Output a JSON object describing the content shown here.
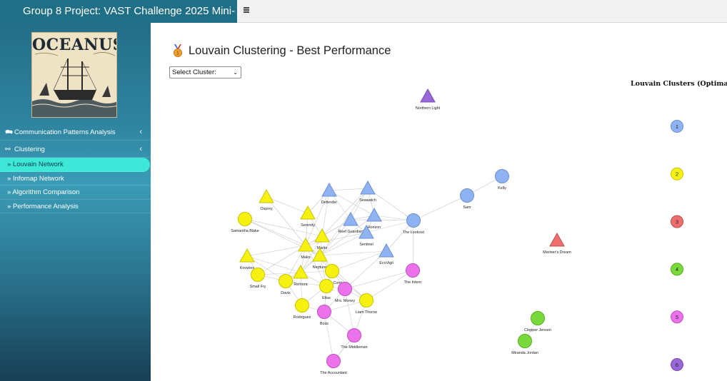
{
  "header": {
    "title": "Group 8 Project: VAST Challenge 2025 Mini-",
    "toggle_icon": "hamburger-menu-icon"
  },
  "sidebar": {
    "logo_text": "OCEANUS",
    "menu": [
      {
        "label": "Communication Patterns Analysis",
        "icon": "comments-icon",
        "chevron": "‹"
      },
      {
        "label": "Clustering",
        "icon": "network-icon",
        "chevron": "‹"
      }
    ],
    "subitems": [
      {
        "label": "Louvain Network",
        "active": true
      },
      {
        "label": "Infomap Network",
        "active": false
      },
      {
        "label": "Algorithm Comparison",
        "active": false
      },
      {
        "label": "Performance Analysis",
        "active": false
      }
    ],
    "subitem_prefix": "»"
  },
  "main": {
    "title": "Louvain Clustering - Best Performance",
    "title_icon": "medal-icon",
    "select": {
      "selected": "Select Cluster:"
    },
    "legend": {
      "title": "Louvain Clusters (Optimal)",
      "items": [
        {
          "label": "1",
          "color": "#8fb3f2"
        },
        {
          "label": "2",
          "color": "#f6f110"
        },
        {
          "label": "3",
          "color": "#ee6e6e"
        },
        {
          "label": "4",
          "color": "#78d83c"
        },
        {
          "label": "5",
          "color": "#ec72ec"
        },
        {
          "label": "6",
          "color": "#9a67d8"
        }
      ]
    }
  },
  "graph": {
    "nodes": [
      {
        "id": "northern-light",
        "label": "Northern Light",
        "cluster": 6,
        "shape": "triangle"
      },
      {
        "id": "kelly",
        "label": "Kelly",
        "cluster": 1,
        "shape": "circle"
      },
      {
        "id": "sam",
        "label": "Sam",
        "cluster": 1,
        "shape": "circle"
      },
      {
        "id": "the-lookout",
        "label": "The Lookout",
        "cluster": 1,
        "shape": "circle"
      },
      {
        "id": "defender",
        "label": "Defender",
        "cluster": 1,
        "shape": "triangle"
      },
      {
        "id": "seawatch",
        "label": "Seawatch",
        "cluster": 1,
        "shape": "triangle"
      },
      {
        "id": "reef-guardian",
        "label": "Reef Guardian",
        "cluster": 1,
        "shape": "triangle"
      },
      {
        "id": "horizon",
        "label": "Horizon",
        "cluster": 1,
        "shape": "triangle"
      },
      {
        "id": "sentinel",
        "label": "Sentinel",
        "cluster": 1,
        "shape": "triangle"
      },
      {
        "id": "ecovigil",
        "label": "EcoVigil",
        "cluster": 1,
        "shape": "triangle"
      },
      {
        "id": "mariners-dream",
        "label": "Mariner's Dream",
        "cluster": 3,
        "shape": "triangle"
      },
      {
        "id": "osprey",
        "label": "Osprey",
        "cluster": 2,
        "shape": "triangle"
      },
      {
        "id": "serenity",
        "label": "Serenity",
        "cluster": 2,
        "shape": "triangle"
      },
      {
        "id": "samantha-blake",
        "label": "Samantha Blake",
        "cluster": 2,
        "shape": "circle"
      },
      {
        "id": "marlin",
        "label": "Marlin",
        "cluster": 2,
        "shape": "triangle"
      },
      {
        "id": "mako",
        "label": "Mako",
        "cluster": 2,
        "shape": "triangle"
      },
      {
        "id": "neptune",
        "label": "Neptune",
        "cluster": 2,
        "shape": "triangle"
      },
      {
        "id": "knowles",
        "label": "Knowles",
        "cluster": 2,
        "shape": "triangle"
      },
      {
        "id": "small-fry",
        "label": "Small Fry",
        "cluster": 2,
        "shape": "circle"
      },
      {
        "id": "remora",
        "label": "Remora",
        "cluster": 2,
        "shape": "triangle"
      },
      {
        "id": "davis",
        "label": "Davis",
        "cluster": 2,
        "shape": "circle"
      },
      {
        "id": "nadia-conti",
        "label": "Nadia Conti",
        "cluster": 2,
        "shape": "circle"
      },
      {
        "id": "elise",
        "label": "Elise",
        "cluster": 2,
        "shape": "circle"
      },
      {
        "id": "liam-thorne",
        "label": "Liam Thorne",
        "cluster": 2,
        "shape": "circle"
      },
      {
        "id": "rodriguez",
        "label": "Rodriguez",
        "cluster": 2,
        "shape": "circle"
      },
      {
        "id": "mrs-money",
        "label": "Mrs. Money",
        "cluster": 5,
        "shape": "circle"
      },
      {
        "id": "the-intern",
        "label": "The Intern",
        "cluster": 5,
        "shape": "circle"
      },
      {
        "id": "boss",
        "label": "Boss",
        "cluster": 5,
        "shape": "circle"
      },
      {
        "id": "the-middleman",
        "label": "The Middleman",
        "cluster": 5,
        "shape": "circle"
      },
      {
        "id": "the-accountant",
        "label": "The Accountant",
        "cluster": 5,
        "shape": "circle"
      },
      {
        "id": "clepper-jensen",
        "label": "Clepper Jensen",
        "cluster": 4,
        "shape": "circle"
      },
      {
        "id": "miranda-jordan",
        "label": "Miranda Jordan",
        "cluster": 4,
        "shape": "circle"
      }
    ],
    "edges": [
      [
        "kelly",
        "sam"
      ],
      [
        "sam",
        "the-lookout"
      ],
      [
        "the-lookout",
        "horizon"
      ],
      [
        "the-lookout",
        "sentinel"
      ],
      [
        "the-lookout",
        "ecovigil"
      ],
      [
        "the-lookout",
        "the-intern"
      ],
      [
        "the-lookout",
        "reef-guardian"
      ],
      [
        "the-lookout",
        "seawatch"
      ],
      [
        "defender",
        "seawatch"
      ],
      [
        "defender",
        "reef-guardian"
      ],
      [
        "defender",
        "horizon"
      ],
      [
        "defender",
        "serenity"
      ],
      [
        "defender",
        "mako"
      ],
      [
        "defender",
        "marlin"
      ],
      [
        "seawatch",
        "horizon"
      ],
      [
        "seawatch",
        "reef-guardian"
      ],
      [
        "seawatch",
        "marlin"
      ],
      [
        "seawatch",
        "neptune"
      ],
      [
        "reef-guardian",
        "horizon"
      ],
      [
        "reef-guardian",
        "sentinel"
      ],
      [
        "reef-guardian",
        "marlin"
      ],
      [
        "reef-guardian",
        "mako"
      ],
      [
        "reef-guardian",
        "neptune"
      ],
      [
        "horizon",
        "sentinel"
      ],
      [
        "horizon",
        "neptune"
      ],
      [
        "sentinel",
        "neptune"
      ],
      [
        "sentinel",
        "mako"
      ],
      [
        "ecovigil",
        "nadia-conti"
      ],
      [
        "ecovigil",
        "neptune"
      ],
      [
        "ecovigil",
        "mrs-money"
      ],
      [
        "osprey",
        "mako"
      ],
      [
        "osprey",
        "serenity"
      ],
      [
        "serenity",
        "marlin"
      ],
      [
        "serenity",
        "mako"
      ],
      [
        "samantha-blake",
        "mako"
      ],
      [
        "samantha-blake",
        "marlin"
      ],
      [
        "samantha-blake",
        "neptune"
      ],
      [
        "marlin",
        "mako"
      ],
      [
        "marlin",
        "neptune"
      ],
      [
        "marlin",
        "remora"
      ],
      [
        "mako",
        "neptune"
      ],
      [
        "mako",
        "knowles"
      ],
      [
        "mako",
        "small-fry"
      ],
      [
        "mako",
        "remora"
      ],
      [
        "mako",
        "davis"
      ],
      [
        "mako",
        "nadia-conti"
      ],
      [
        "mako",
        "elise"
      ],
      [
        "neptune",
        "nadia-conti"
      ],
      [
        "neptune",
        "remora"
      ],
      [
        "neptune",
        "elise"
      ],
      [
        "neptune",
        "liam-thorne"
      ],
      [
        "neptune",
        "davis"
      ],
      [
        "knowles",
        "small-fry"
      ],
      [
        "knowles",
        "remora"
      ],
      [
        "knowles",
        "davis"
      ],
      [
        "small-fry",
        "remora"
      ],
      [
        "small-fry",
        "davis"
      ],
      [
        "remora",
        "davis"
      ],
      [
        "remora",
        "nadia-conti"
      ],
      [
        "remora",
        "elise"
      ],
      [
        "remora",
        "rodriguez"
      ],
      [
        "davis",
        "rodriguez"
      ],
      [
        "davis",
        "elise"
      ],
      [
        "nadia-conti",
        "elise"
      ],
      [
        "nadia-conti",
        "mrs-money"
      ],
      [
        "nadia-conti",
        "liam-thorne"
      ],
      [
        "elise",
        "mrs-money"
      ],
      [
        "elise",
        "rodriguez"
      ],
      [
        "elise",
        "boss"
      ],
      [
        "mrs-money",
        "liam-thorne"
      ],
      [
        "mrs-money",
        "boss"
      ],
      [
        "mrs-money",
        "the-middleman"
      ],
      [
        "mrs-money",
        "the-intern"
      ],
      [
        "liam-thorne",
        "the-intern"
      ],
      [
        "liam-thorne",
        "boss"
      ],
      [
        "rodriguez",
        "boss"
      ],
      [
        "boss",
        "the-middleman"
      ],
      [
        "boss",
        "the-accountant"
      ],
      [
        "the-middleman",
        "the-accountant"
      ],
      [
        "the-middleman",
        "liam-thorne"
      ],
      [
        "clepper-jensen",
        "miranda-jordan"
      ]
    ]
  }
}
